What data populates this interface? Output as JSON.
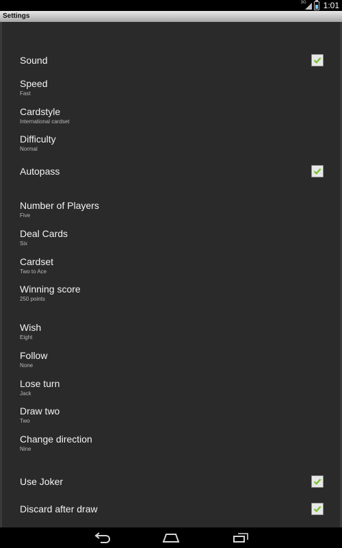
{
  "status_bar": {
    "network": "3G",
    "time": "1:01"
  },
  "title": "Settings",
  "colors": {
    "checkmark": "#7ac231",
    "panel": "#2a2a2a",
    "status_accent": "#9bd2ee"
  },
  "settings": [
    {
      "title": "Sound",
      "checked": true
    },
    {
      "title": "Speed",
      "summary": "Fast"
    },
    {
      "title": "Cardstyle",
      "summary": "International cardset"
    },
    {
      "title": "Difficulty",
      "summary": "Normal"
    },
    {
      "title": "Autopass",
      "checked": true
    },
    {
      "title": "Number of Players",
      "summary": "Five"
    },
    {
      "title": "Deal Cards",
      "summary": "Six"
    },
    {
      "title": "Cardset",
      "summary": "Two to Ace"
    },
    {
      "title": "Winning score",
      "summary": "250 points"
    },
    {
      "title": "Wish",
      "summary": "Eight"
    },
    {
      "title": "Follow",
      "summary": "None"
    },
    {
      "title": "Lose turn",
      "summary": "Jack"
    },
    {
      "title": "Draw two",
      "summary": "Two"
    },
    {
      "title": "Change direction",
      "summary": "Nine"
    },
    {
      "title": "Use Joker",
      "checked": true
    },
    {
      "title": "Discard after draw",
      "checked": true
    }
  ],
  "nav_bar": {
    "icons": [
      "back-icon",
      "home-icon",
      "recent-apps-icon"
    ]
  }
}
